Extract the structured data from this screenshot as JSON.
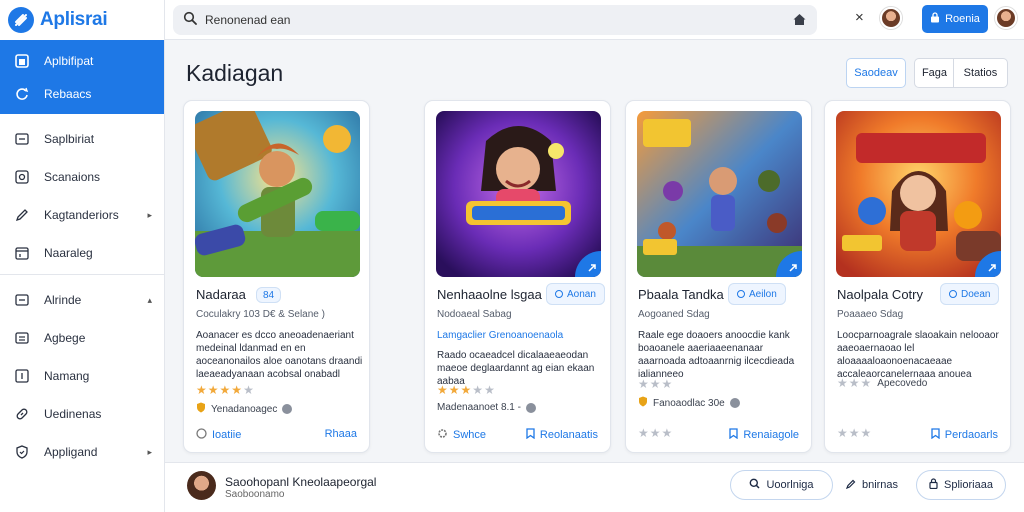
{
  "app": {
    "name": "Aplisrai",
    "accent": "#1e78e6"
  },
  "sidebar": {
    "active_items": [
      {
        "label": "Aplbifipat",
        "icon": "grid-icon"
      },
      {
        "label": "Rebaacs",
        "icon": "refresh-icon"
      }
    ],
    "items": [
      {
        "label": "Saplbiriat",
        "icon": "card-icon"
      },
      {
        "label": "Scanaions",
        "icon": "scan-icon"
      },
      {
        "label": "Kagtanderiors",
        "icon": "pencil-icon",
        "arrow": "▸"
      },
      {
        "label": "Naaraleg",
        "icon": "calendar-icon"
      },
      {
        "label": "Alrinde",
        "icon": "square-icon",
        "arrow": "▴"
      },
      {
        "label": "Agbege",
        "icon": "list-icon"
      },
      {
        "label": "Namang",
        "icon": "box-icon"
      },
      {
        "label": "Uedinenas",
        "icon": "link-icon"
      },
      {
        "label": "Appligand",
        "icon": "shield-icon",
        "arrow": "▸"
      }
    ]
  },
  "topbar": {
    "search_value": "Renonenad ean",
    "close_label": "×",
    "primary_button": "Roenia"
  },
  "main": {
    "title": "Kadiagan",
    "header_buttons": {
      "sort": "Saodeav",
      "page": "Faga",
      "status": "Statios"
    }
  },
  "cards": [
    {
      "title": "Nadaraa",
      "pill": "84",
      "sub": "Coculakry 103 D€ & Selane )",
      "desc": "Aoanacer es dcco aneoadenaeriant medeinal ldanmad en en aoceanonailos aloe oanotans draandi laeaeadyanaan acobsal onabadl",
      "rating": 4,
      "meta": "Yenadanoagec",
      "foot_left": "Ioatiie",
      "foot_right": "Rhaaa"
    },
    {
      "title": "Nenhaaolne lsgaa",
      "pill": "Aonan",
      "sub": "Nodoaeal Sabag",
      "desc_blue": "Lamgaclier Grenoanoenaola",
      "desc": "Raado ocaeadcel dicalaaeaeodan maeoe deglaardannt ag eian ekaan aabaa",
      "rating": 3,
      "meta": "Madenaanoet 8.1 -",
      "foot_left": "Swhce",
      "foot_right": "Reolanaatis"
    },
    {
      "title": "Pbaala Tandka",
      "pill": "Aeilon",
      "sub": "Aogoaned Sdag",
      "desc": "Raale ege doaoers anoocdie kank boaoanele aaeriaaeenanaar aaarnoada adtoaanrnig ilcecdieada ialianneeo",
      "rating": 0,
      "meta": "Fanoaodlac 30e",
      "foot_left": "",
      "foot_right": "Renaiagole"
    },
    {
      "title": "Naolpala Cotry",
      "pill": "Doean",
      "sub": "Poaaaeo Sdag",
      "desc": "Loocparnoagrale slaoakain nelooaor aaeoaernaoao lel aloaaaaloaonoenacaeaae accaleaorcanelernaaa anouea",
      "rating": 0,
      "meta": "Apecovedo",
      "foot_left": "",
      "foot_right": "Perdaoarls"
    }
  ],
  "bottom": {
    "name": "Saoohopanl Kneolaapeorgal",
    "sub": "Saoboonamo",
    "buttons": [
      "Uoorlniga",
      "bnirnas",
      "Splioriaaa"
    ]
  }
}
